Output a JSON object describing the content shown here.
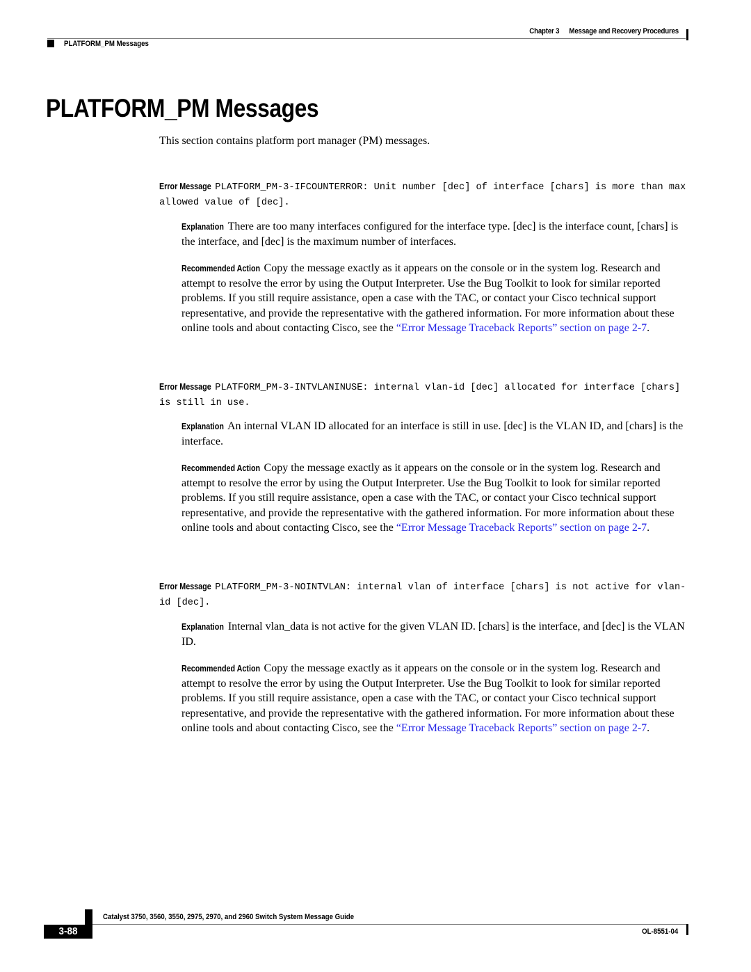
{
  "header": {
    "chapter": "Chapter 3",
    "chapter_title": "Message and Recovery Procedures",
    "section": "PLATFORM_PM Messages"
  },
  "title": "PLATFORM_PM Messages",
  "intro": "This section contains platform port manager (PM) messages.",
  "labels": {
    "error_message": "Error Message",
    "explanation": "Explanation",
    "recommended_action": "Recommended Action"
  },
  "messages": [
    {
      "code": "PLATFORM_PM-3-IFCOUNTERROR: Unit number [dec] of interface [chars] is more than max allowed value of [dec].",
      "explanation": "There are too many interfaces configured for the interface type. [dec] is the interface count, [chars] is the interface, and [dec] is the maximum number of interfaces.",
      "action": "Copy the message exactly as it appears on the console or in the system log. Research and attempt to resolve the error by using the Output Interpreter. Use the Bug Toolkit to look for similar reported problems. If you still require assistance, open a case with the TAC, or contact your Cisco technical support representative, and provide the representative with the gathered information. For more information about these online tools and about contacting Cisco, see the ",
      "action_link": "“Error Message Traceback Reports” section on page 2-7",
      "action_end": "."
    },
    {
      "code": "PLATFORM_PM-3-INTVLANINUSE: internal vlan-id [dec] allocated for interface [chars] is still in use.",
      "explanation": "An internal VLAN ID allocated for an interface is still in use. [dec] is the VLAN ID, and [chars] is the interface.",
      "action": "Copy the message exactly as it appears on the console or in the system log. Research and attempt to resolve the error by using the Output Interpreter. Use the Bug Toolkit to look for similar reported problems. If you still require assistance, open a case with the TAC, or contact your Cisco technical support representative, and provide the representative with the gathered information. For more information about these online tools and about contacting Cisco, see the ",
      "action_link": "“Error Message Traceback Reports” section on page 2-7",
      "action_end": "."
    },
    {
      "code": "PLATFORM_PM-3-NOINTVLAN: internal vlan of interface [chars] is not active for vlan-id [dec].",
      "explanation": "Internal vlan_data is not active for the given VLAN ID. [chars] is the interface, and [dec] is the VLAN ID.",
      "action": "Copy the message exactly as it appears on the console or in the system log. Research and attempt to resolve the error by using the Output Interpreter. Use the Bug Toolkit to look for similar reported problems. If you still require assistance, open a case with the TAC, or contact your Cisco technical support representative, and provide the representative with the gathered information. For more information about these online tools and about contacting Cisco, see the ",
      "action_link": "“Error Message Traceback Reports” section on page 2-7",
      "action_end": "."
    }
  ],
  "footer": {
    "guide_title": "Catalyst 3750, 3560, 3550, 2975, 2970, and 2960 Switch System Message Guide",
    "page_number": "3-88",
    "doc_number": "OL-8551-04"
  },
  "colors": {
    "link": "#2323e6",
    "text": "#000000",
    "rule": "#777777"
  }
}
